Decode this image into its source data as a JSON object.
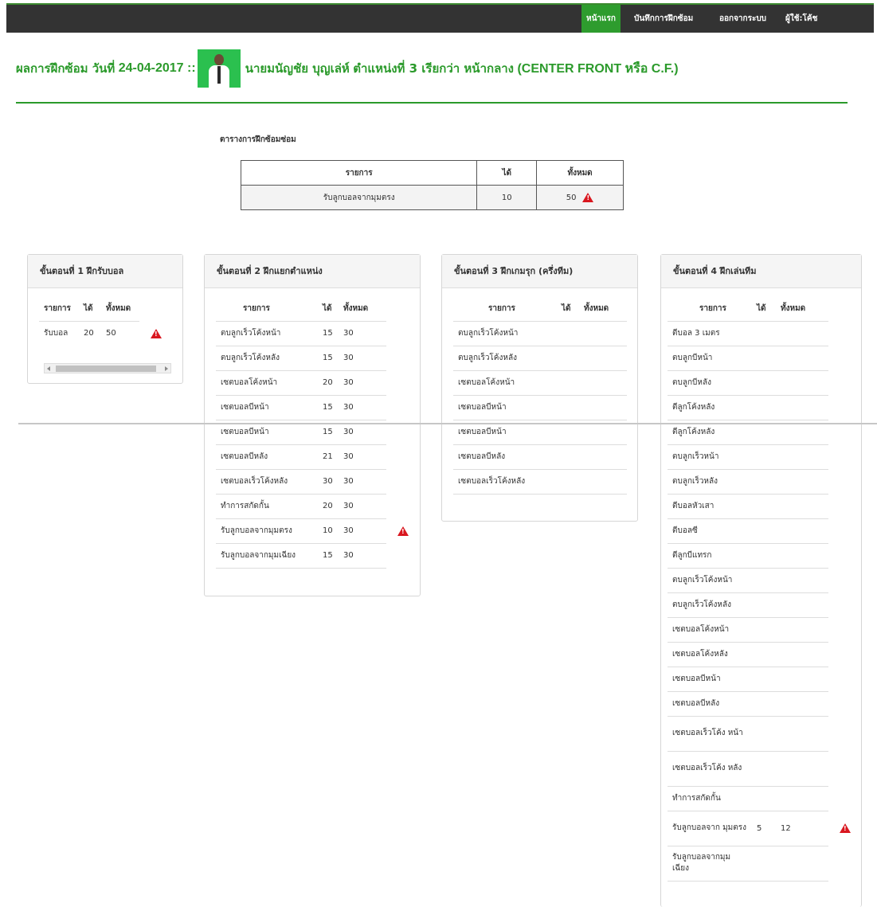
{
  "navbar": {
    "items": [
      {
        "label": "หน้าแรก",
        "active": true
      },
      {
        "label": "บันทึกการฝึกซ้อม",
        "active": false
      },
      {
        "label": "ออกจากระบบ",
        "active": false
      },
      {
        "label": "ผู้ใช้:โค้ช",
        "active": false
      }
    ]
  },
  "heading": {
    "prefix": "ผลการฝึกซ้อม วันที่",
    "date": "24-04-2017 ::",
    "person": "นายมนัญชัย บุญเล่ห์",
    "position": "ตำแหน่งที่ 3 เรียกว่า หน้ากลาง",
    "position_en": "(CENTER FRONT หรือ C.F.)"
  },
  "summary": {
    "title": "ตารางการฝึกซ้อมซ่อม",
    "headers": [
      "รายการ",
      "ได้",
      "ทั้งหมด"
    ],
    "rows": [
      {
        "item": "รับลูกบอลจากมุมตรง",
        "got": "10",
        "total": "50",
        "warning": true
      }
    ]
  },
  "panels": [
    {
      "title": "ขั้นตอนที่ 1 ฝึกรับบอล",
      "headers": [
        "รายการ",
        "ได้",
        "ทั้งหมด"
      ],
      "rows": [
        {
          "item": "รับบอล",
          "got": "20",
          "total": "50",
          "warning": true
        }
      ]
    },
    {
      "title": "ขั้นตอนที่ 2 ฝึกแยกตำแหน่ง",
      "headers": [
        "รายการ",
        "ได้",
        "ทั้งหมด"
      ],
      "rows": [
        {
          "item": "ตบลูกเร็วโค้งหน้า",
          "got": "15",
          "total": "30"
        },
        {
          "item": "ตบลูกเร็วโค้งหลัง",
          "got": "15",
          "total": "30"
        },
        {
          "item": "เซตบอลโค้งหน้า",
          "got": "20",
          "total": "30"
        },
        {
          "item": "เซตบอลบีหน้า",
          "got": "15",
          "total": "30"
        },
        {
          "item": "เซตบอลบีหน้า",
          "got": "15",
          "total": "30"
        },
        {
          "item": "เซตบอลบีหลัง",
          "got": "21",
          "total": "30"
        },
        {
          "item": "เซตบอลเร็วโค้งหลัง",
          "got": "30",
          "total": "30"
        },
        {
          "item": "ทำการสกัดกั้น",
          "got": "20",
          "total": "30"
        },
        {
          "item": "รับลูกบอลจากมุมตรง",
          "got": "10",
          "total": "30",
          "warning": true
        },
        {
          "item": "รับลูกบอลจากมุมเฉียง",
          "got": "15",
          "total": "30"
        }
      ]
    },
    {
      "title": "ขั้นตอนที่ 3 ฝึกเกมรุก (ครึ่งทีม)",
      "headers": [
        "รายการ",
        "ได้",
        "ทั้งหมด"
      ],
      "rows": [
        {
          "item": "ตบลูกเร็วโค้งหน้า",
          "got": "",
          "total": ""
        },
        {
          "item": "ตบลูกเร็วโค้งหลัง",
          "got": "",
          "total": ""
        },
        {
          "item": "เซตบอลโค้งหน้า",
          "got": "",
          "total": ""
        },
        {
          "item": "เซตบอลบีหน้า",
          "got": "",
          "total": ""
        },
        {
          "item": "เซตบอลบีหน้า",
          "got": "",
          "total": ""
        },
        {
          "item": "เซตบอลบีหลัง",
          "got": "",
          "total": ""
        },
        {
          "item": "เซตบอลเร็วโค้งหลัง",
          "got": "",
          "total": ""
        }
      ]
    },
    {
      "title": "ขั้นตอนที่ 4 ฝึกเล่นทีม",
      "headers": [
        "รายการ",
        "ได้",
        "ทั้งหมด"
      ],
      "rows": [
        {
          "item": "ตีบอล 3 เมตร",
          "got": "",
          "total": ""
        },
        {
          "item": "ตบลูกบีหน้า",
          "got": "",
          "total": ""
        },
        {
          "item": "ตบลูกบีหลัง",
          "got": "",
          "total": ""
        },
        {
          "item": "ตีลูกโค้งหลัง",
          "got": "",
          "total": ""
        },
        {
          "item": "ตีลูกโค้งหลัง",
          "got": "",
          "total": ""
        },
        {
          "item": "ตบลูกเร็วหน้า",
          "got": "",
          "total": ""
        },
        {
          "item": "ตบลูกเร็วหลัง",
          "got": "",
          "total": ""
        },
        {
          "item": "ตีบอลหัวเสา",
          "got": "",
          "total": ""
        },
        {
          "item": "ตีบอลซี",
          "got": "",
          "total": ""
        },
        {
          "item": "ตีลูกบีแทรก",
          "got": "",
          "total": ""
        },
        {
          "item": "ตบลูกเร็วโค้งหน้า",
          "got": "",
          "total": ""
        },
        {
          "item": "ตบลูกเร็วโค้งหลัง",
          "got": "",
          "total": ""
        },
        {
          "item": "เซตบอลโค้งหน้า",
          "got": "",
          "total": ""
        },
        {
          "item": "เซตบอลโค้งหลัง",
          "got": "",
          "total": ""
        },
        {
          "item": "เซตบอลบีหน้า",
          "got": "",
          "total": ""
        },
        {
          "item": "เซตบอลบีหลัง",
          "got": "",
          "total": ""
        },
        {
          "item": "เซตบอลเร็วโค้ง หน้า",
          "got": "",
          "total": "",
          "tall": true
        },
        {
          "item": "เซตบอลเร็วโค้ง หลัง",
          "got": "",
          "total": "",
          "tall": true
        },
        {
          "item": "ทำการสกัดกั้น",
          "got": "",
          "total": ""
        },
        {
          "item": "รับลูกบอลจาก มุมตรง",
          "got": "5",
          "total": "12",
          "warning": true,
          "tall": true
        },
        {
          "item": "รับลูกบอลจากมุม เฉียง",
          "got": "",
          "total": "",
          "tall": true
        }
      ]
    }
  ],
  "colors": {
    "navbar": "#333333",
    "active": "#2e9c2e",
    "heading": "#2b9a2b",
    "warning": "#d9171f"
  }
}
